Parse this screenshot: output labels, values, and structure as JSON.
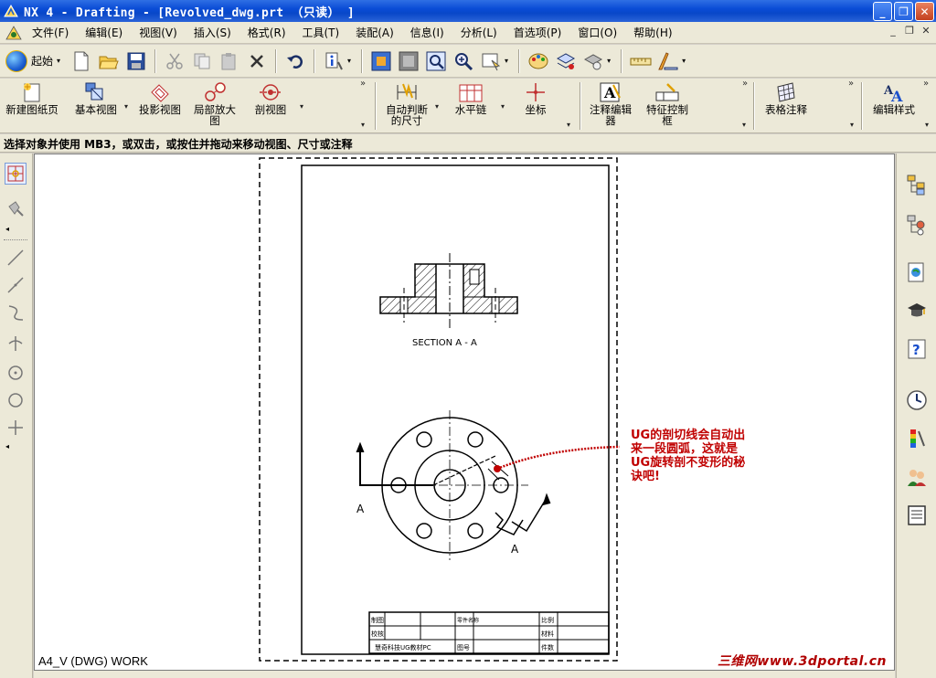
{
  "window": {
    "title": "NX 4 - Drafting - [Revolved_dwg.prt  （只读）  ]",
    "buttons": [
      "_",
      "❐",
      "✕"
    ]
  },
  "menu": {
    "items": [
      "文件(F)",
      "编辑(E)",
      "视图(V)",
      "插入(S)",
      "格式(R)",
      "工具(T)",
      "装配(A)",
      "信息(I)",
      "分析(L)",
      "首选项(P)",
      "窗口(O)",
      "帮助(H)"
    ],
    "mdi_controls": [
      "_",
      "❐",
      "✕"
    ]
  },
  "toolbar1": {
    "start_label": "起始",
    "icons": [
      "new-icon",
      "open-icon",
      "save-icon",
      "cut-icon",
      "copy-icon",
      "paste-icon",
      "delete-icon",
      "undo-icon",
      "info-icon",
      "fit-icon",
      "zoom-window-icon",
      "zoom-icon",
      "zoom-in-icon",
      "pan-icon",
      "palette-icon",
      "layer-icon",
      "visibility-icon",
      "measure-icon",
      "drafting-tools-icon"
    ]
  },
  "toolbar2": {
    "buttons": [
      {
        "label": "新建图纸页",
        "icon": "new-sheet-icon"
      },
      {
        "label": "基本视图",
        "icon": "base-view-icon"
      },
      {
        "label": "投影视图",
        "icon": "projected-view-icon"
      },
      {
        "label": "局部放大图",
        "icon": "detail-view-icon"
      },
      {
        "label": "剖视图",
        "icon": "section-view-icon"
      },
      {
        "label": "自动判断的尺寸",
        "icon": "inferred-dimension-icon"
      },
      {
        "label": "水平链",
        "icon": "horizontal-chain-icon"
      },
      {
        "label": "坐标",
        "icon": "ordinate-icon"
      },
      {
        "label": "注释编辑器",
        "icon": "annotation-editor-icon"
      },
      {
        "label": "特征控制框",
        "icon": "feature-control-frame-icon"
      },
      {
        "label": "表格注释",
        "icon": "tabular-note-icon"
      },
      {
        "label": "编辑样式",
        "icon": "edit-style-icon"
      }
    ]
  },
  "status": {
    "prompt": "选择对象并使用 MB3，或双击，或按住并拖动来移动视图、尺寸或注释"
  },
  "left_toolbar": {
    "icons": [
      "select-view-icon",
      "drag-icon",
      "line-icon",
      "line-alt-icon",
      "arc-icon",
      "point-icon",
      "circle-center-icon",
      "circle-icon",
      "crosshair-icon"
    ]
  },
  "right_toolbar": {
    "icons": [
      "assembly-navigator-icon",
      "part-navigator-icon",
      "web-browser-icon",
      "training-icon",
      "help-icon",
      "history-icon",
      "palette-icon",
      "roles-icon",
      "system-icon"
    ]
  },
  "drawing": {
    "section_label": "SECTION  A - A",
    "section_letter_left": "A",
    "section_letter_right": "A",
    "title_block": {
      "cells": [
        "制图",
        "校核",
        "零件名称",
        "比例",
        "材料",
        "件数",
        "图号",
        "慧奇科技UG教材PC"
      ]
    }
  },
  "annotation": {
    "lines": [
      "UG的剖切线会自动出",
      "来一段圆弧，这就是",
      "UG旋转剖不变形的秘",
      "诀吧!"
    ],
    "color": "#c00000"
  },
  "view_label": "A4_V (DWG) WORK",
  "watermark": "三维网www.3dportal.cn",
  "colors": {
    "titlebar": "#0a4cd6",
    "chrome": "#ece9d8",
    "annotation": "#c00000"
  }
}
